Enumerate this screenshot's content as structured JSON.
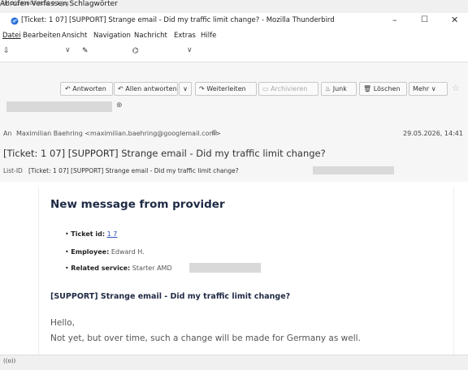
{
  "file_label": "[0] 20260602-0100-0-1.jpg",
  "window": {
    "title": "[Ticket: 1      07] [SUPPORT] Strange email - Did my traffic limit change? - Mozilla Thunderbird",
    "minimize": "–",
    "maximize": "☐",
    "close": "✕"
  },
  "menu": [
    "Datei",
    "Bearbeiten",
    "Ansicht",
    "Navigation",
    "Nachricht",
    "Extras",
    "Hilfe"
  ],
  "mailbar": {
    "fetch": "Abrufen",
    "compose": "Verfassen",
    "tags": "Schlagwörter"
  },
  "toolbar": {
    "reply": "Antworten",
    "reply_all": "Allen antworten",
    "forward": "Weiterleiten",
    "archive": "Archivieren",
    "junk": "Junk",
    "delete": "Löschen",
    "more": "Mehr"
  },
  "header": {
    "to_label": "An",
    "to_value": "Maximilian Baehring <maximilian.baehring@googlemail.com>",
    "date": "29.05.2026, 14:41",
    "subject": "[Ticket: 1      07] [SUPPORT] Strange email - Did my traffic limit change?",
    "list_id_label": "List-ID",
    "list_id_value": "[Ticket: 1      07] [SUPPORT] Strange email - Did my traffic limit change?"
  },
  "message": {
    "heading": "New message from provider",
    "fields": [
      {
        "label": "Ticket id:",
        "value": "1       7"
      },
      {
        "label": "Employee:",
        "value": "Edward H."
      },
      {
        "label": "Related service:",
        "value": "Starter AMD"
      }
    ],
    "subject": "[SUPPORT] Strange email - Did my traffic limit change?",
    "greeting": "Hello,",
    "body": "Not yet, but over time, such a change will be made for Germany as well."
  },
  "statusbar": {
    "icon_text": "((o))"
  }
}
